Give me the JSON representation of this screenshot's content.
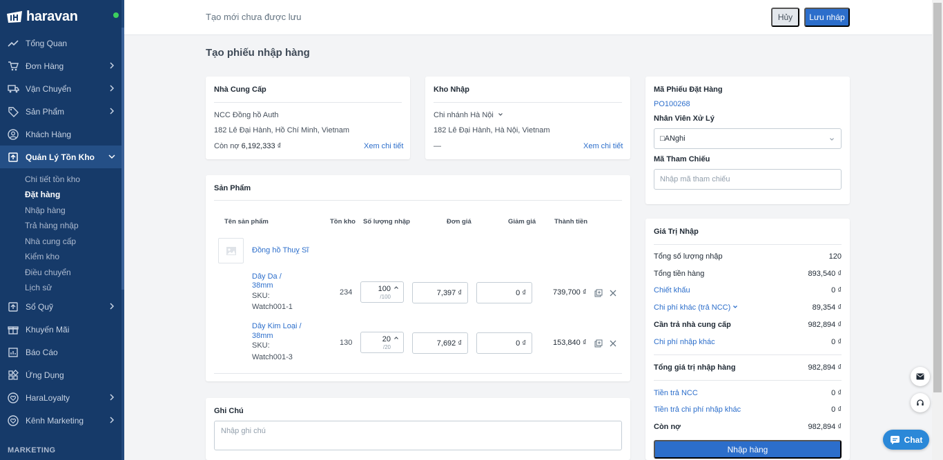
{
  "brand": {
    "name": "haravan"
  },
  "sidebar": {
    "items": [
      {
        "label": "Tổng Quan",
        "icon": "trend-icon"
      },
      {
        "label": "Đơn Hàng",
        "icon": "cart-icon"
      },
      {
        "label": "Vận Chuyển",
        "icon": "truck-icon"
      },
      {
        "label": "Sản Phẩm",
        "icon": "tag-icon"
      },
      {
        "label": "Khách Hàng",
        "icon": "user-icon"
      },
      {
        "label": "Quản Lý Tồn Kho",
        "icon": "inventory-icon"
      },
      {
        "label": "Sổ Quỹ",
        "icon": "cashbook-icon"
      },
      {
        "label": "Khuyến Mãi",
        "icon": "gift-icon"
      },
      {
        "label": "Báo Cáo",
        "icon": "report-icon"
      },
      {
        "label": "Ứng Dụng",
        "icon": "apps-icon"
      },
      {
        "label": "HaraLoyalty",
        "icon": "heart-icon"
      },
      {
        "label": "Kênh Marketing",
        "icon": "marketing-icon"
      }
    ],
    "subitems": [
      "Chi tiết tồn kho",
      "Đặt hàng",
      "Nhập hàng",
      "Trả hàng nhập",
      "Nhà cung cấp",
      "Kiểm kho",
      "Điều chuyển",
      "Lịch sử"
    ],
    "section_label": "MARKETING"
  },
  "header": {
    "status": "Tạo mới chưa được lưu",
    "cancel_label": "Hủy",
    "save_label": "Lưu nháp"
  },
  "page_title": "Tạo phiếu nhập hàng",
  "supplier": {
    "title": "Nhà Cung Cấp",
    "name": "NCC Đồng hồ Auth",
    "address": "182 Lê Đại Hành, Hồ Chí Minh, Vietnam",
    "debt_label": "Còn nợ",
    "debt_value": "6,192,333 ₫",
    "detail_link": "Xem chi tiết"
  },
  "warehouse": {
    "title": "Kho Nhập",
    "name": "Chi nhánh Hà Nội",
    "address": "182 Lê Đại Hành, Hà Nội, Vietnam",
    "dash": "—",
    "detail_link": "Xem chi tiết"
  },
  "products": {
    "title": "Sản Phẩm",
    "columns": [
      "Tên sản phẩm",
      "Tồn kho",
      "Số lượng nhập",
      "Đơn giá",
      "Giảm giá",
      "Thành tiền"
    ],
    "product_name": "Đồng hồ Thuỵ Sĩ",
    "variants": [
      {
        "name_line1": "Dây Da /",
        "name_line2": "38mm",
        "sku_label": "SKU:",
        "sku": "Watch001-1",
        "stock": "234",
        "qty": "100",
        "qty_max": "/100",
        "price": "7,397 ₫",
        "discount": "0 ₫",
        "total": "739,700 ₫"
      },
      {
        "name_line1": "Dây Kim Loại /",
        "name_line2": "38mm",
        "sku_label": "SKU:",
        "sku": "Watch001-3",
        "stock": "130",
        "qty": "20",
        "qty_max": "/20",
        "price": "7,692 ₫",
        "discount": "0 ₫",
        "total": "153,840 ₫"
      }
    ]
  },
  "notes": {
    "title": "Ghi Chú",
    "placeholder": "Nhập ghi chú"
  },
  "order_info": {
    "po_label": "Mã Phiếu Đặt Hàng",
    "po_value": "PO100268",
    "staff_label": "Nhân Viên Xử Lý",
    "staff_value": "□ANghi",
    "ref_label": "Mã Tham Chiếu",
    "ref_placeholder": "Nhập mã tham chiếu"
  },
  "summary": {
    "title": "Giá Trị Nhập",
    "rows": [
      {
        "label": "Tổng số lượng nhập",
        "value": "120"
      },
      {
        "label": "Tổng tiền hàng",
        "value": "893,540 ₫"
      },
      {
        "label": "Chiết khấu",
        "value": "0 ₫"
      },
      {
        "label": "Chi phí khác (trả NCC)",
        "value": "89,354 ₫"
      },
      {
        "label": "Cần trả nhà cung cấp",
        "value": "982,894 ₫"
      },
      {
        "label": "Chi phí nhập khác",
        "value": "0 ₫"
      },
      {
        "label": "Tổng giá trị nhập hàng",
        "value": "982,894 ₫"
      },
      {
        "label": "Tiền trả NCC",
        "value": "0 ₫"
      },
      {
        "label": "Tiền trả chi phí nhập khác",
        "value": "0 ₫"
      },
      {
        "label": "Còn nợ",
        "value": "982,894 ₫"
      }
    ],
    "submit_label": "Nhập hàng"
  },
  "support": {
    "chat_label": "Chat"
  },
  "colors": {
    "sidebar": "#163a69",
    "primary": "#2c6ecb",
    "active_nav": "#244f86"
  }
}
